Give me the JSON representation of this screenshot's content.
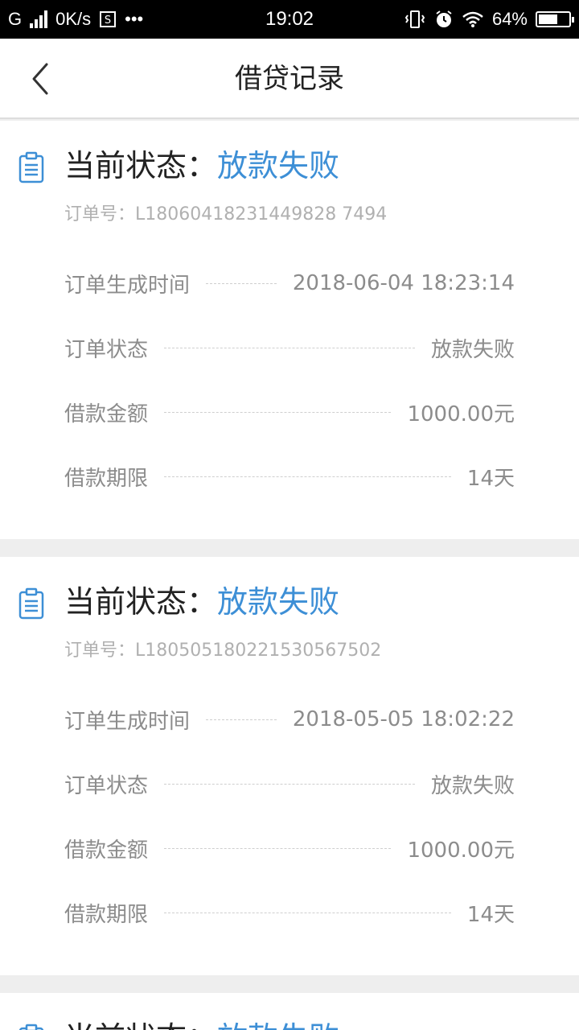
{
  "status_bar": {
    "carrier": "G",
    "net_speed": "0K/s",
    "more": "•••",
    "time": "19:02",
    "battery": "64%",
    "battery_level": 0.64
  },
  "header": {
    "title": "借贷记录"
  },
  "records": [
    {
      "status_label": "当前状态：",
      "status_value": "放款失败",
      "order_no": "订单号：L18060418231449828 7494",
      "rows": [
        {
          "label": "订单生成时间",
          "value": "2018-06-04 18:23:14"
        },
        {
          "label": "订单状态",
          "value": "放款失败"
        },
        {
          "label": "借款金额",
          "value": "1000.00元"
        },
        {
          "label": "借款期限",
          "value": "14天"
        }
      ]
    },
    {
      "status_label": "当前状态：",
      "status_value": "放款失败",
      "order_no": "订单号：L180505180221530567502",
      "rows": [
        {
          "label": "订单生成时间",
          "value": "2018-05-05 18:02:22"
        },
        {
          "label": "订单状态",
          "value": "放款失败"
        },
        {
          "label": "借款金额",
          "value": "1000.00元"
        },
        {
          "label": "借款期限",
          "value": "14天"
        }
      ]
    },
    {
      "status_label": "当前状态：",
      "status_value": "放款失败"
    }
  ],
  "colors": {
    "accent": "#3d8fd6",
    "text_muted": "#8c8c8c",
    "background": "#eeeeee"
  }
}
